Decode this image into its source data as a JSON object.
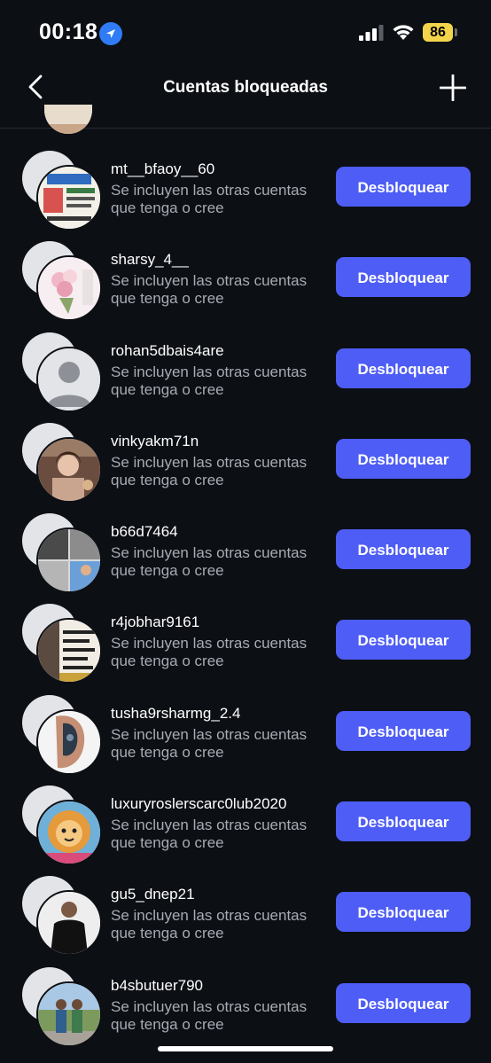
{
  "status_bar": {
    "time": "00:18",
    "battery": "86",
    "battery_color": "#f2d54a",
    "location_color": "#2f7cf6"
  },
  "header": {
    "title": "Cuentas bloqueadas",
    "back_icon": "chevron-left-icon",
    "add_icon": "plus-icon"
  },
  "accent_color": "#4e5df5",
  "accounts": [
    {
      "username": "mt__bfaoy__60",
      "description": "Se incluyen las otras cuentas que tenga o cree",
      "button": "Desbloquear",
      "avatar": "store-flyer"
    },
    {
      "username": "sharsy_4__",
      "description": "Se incluyen las otras cuentas que tenga o cree",
      "button": "Desbloquear",
      "avatar": "flowers"
    },
    {
      "username": "rohan5dbais4are",
      "description": "Se incluyen las otras cuentas que tenga o cree",
      "button": "Desbloquear",
      "avatar": "default-user"
    },
    {
      "username": "vinkyakm71n",
      "description": "Se incluyen las otras cuentas que tenga o cree",
      "button": "Desbloquear",
      "avatar": "woman-portrait"
    },
    {
      "username": "b66d7464",
      "description": "Se incluyen las otras cuentas que tenga o cree",
      "button": "Desbloquear",
      "avatar": "collage"
    },
    {
      "username": "r4jobhar9161",
      "description": "Se incluyen las otras cuentas que tenga o cree",
      "button": "Desbloquear",
      "avatar": "text-post"
    },
    {
      "username": "tusha9rsharmg_2.4",
      "description": "Se incluyen las otras cuentas que tenga o cree",
      "button": "Desbloquear",
      "avatar": "tattoo"
    },
    {
      "username": "luxuryroslerscarc0lub2020",
      "description": "Se incluyen las otras cuentas que tenga o cree",
      "button": "Desbloquear",
      "avatar": "cartoon-lion"
    },
    {
      "username": "gu5_dnep21",
      "description": "Se incluyen las otras cuentas que tenga o cree",
      "button": "Desbloquear",
      "avatar": "man-black-shirt"
    },
    {
      "username": "b4sbutuer790",
      "description": "Se incluyen las otras cuentas que tenga o cree",
      "button": "Desbloquear",
      "avatar": "two-people-outdoors"
    }
  ]
}
